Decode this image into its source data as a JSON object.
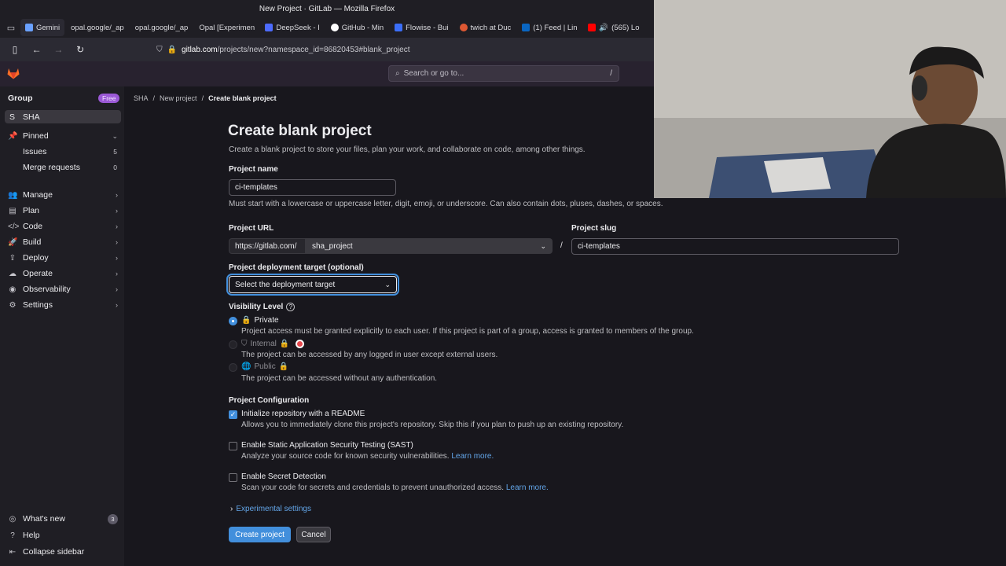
{
  "browser": {
    "window_title": "New Project · GitLab — Mozilla Firefox",
    "tabs": [
      {
        "label": "Gemini",
        "color": "#6aa1ff"
      },
      {
        "label": "opal.google/_ap",
        "color": "#1f1e24"
      },
      {
        "label": "opal.google/_ap",
        "color": "#1f1e24"
      },
      {
        "label": "Opal [Experimen",
        "color": "#1f1e24"
      },
      {
        "label": "DeepSeek - I",
        "color": "#4d6bfe"
      },
      {
        "label": "GitHub - Min",
        "color": "#ffffff"
      },
      {
        "label": "Flowise - Bui",
        "color": "#3b6ef8"
      },
      {
        "label": "twich at Duc",
        "color": "#de5833"
      },
      {
        "label": "(1) Feed | Lin",
        "color": "#0a66c2"
      },
      {
        "label": "(565) Lo",
        "color": "#ff0000"
      }
    ],
    "url_host": "gitlab.com",
    "url_path": "/projects/new?namespace_id=86820453#blank_project"
  },
  "topbar": {
    "search_placeholder": "Search or go to...",
    "search_shortcut": "/"
  },
  "sidebar": {
    "group_label": "Group",
    "plan_badge": "Free",
    "context_initial": "S",
    "context_name": "SHA",
    "pinned_label": "Pinned",
    "pinned_items": [
      {
        "label": "Issues",
        "count": "5"
      },
      {
        "label": "Merge requests",
        "count": "0"
      }
    ],
    "nav_items": [
      {
        "label": "Manage",
        "icon": "users-icon"
      },
      {
        "label": "Plan",
        "icon": "plan-icon"
      },
      {
        "label": "Code",
        "icon": "code-icon"
      },
      {
        "label": "Build",
        "icon": "rocket-icon"
      },
      {
        "label": "Deploy",
        "icon": "deploy-icon"
      },
      {
        "label": "Operate",
        "icon": "cloud-icon"
      },
      {
        "label": "Observability",
        "icon": "eye-icon"
      },
      {
        "label": "Settings",
        "icon": "gear-icon"
      }
    ],
    "whats_new": "What's new",
    "whats_new_count": "3",
    "help": "Help",
    "collapse": "Collapse sidebar"
  },
  "breadcrumb": {
    "items": [
      "SHA",
      "New project",
      "Create blank project"
    ]
  },
  "form": {
    "title": "Create blank project",
    "subtitle": "Create a blank project to store your files, plan your work, and collaborate on code, among other things.",
    "project_name_label": "Project name",
    "project_name_value": "ci-templates",
    "project_name_help": "Must start with a lowercase or uppercase letter, digit, emoji, or underscore. Can also contain dots, pluses, dashes, or spaces.",
    "project_url_label": "Project URL",
    "url_prefix": "https://gitlab.com/",
    "namespace": "sha_project",
    "slug_label": "Project slug",
    "slug_value": "ci-templates",
    "deploy_label": "Project deployment target (optional)",
    "deploy_placeholder": "Select the deployment target",
    "visibility_label": "Visibility Level",
    "visibility": [
      {
        "label": "Private",
        "desc": "Project access must be granted explicitly to each user. If this project is part of a group, access is granted to members of the group.",
        "selected": true,
        "disabled": false
      },
      {
        "label": "Internal",
        "desc": "The project can be accessed by any logged in user except external users.",
        "selected": false,
        "disabled": true
      },
      {
        "label": "Public",
        "desc": "The project can be accessed without any authentication.",
        "selected": false,
        "disabled": true
      }
    ],
    "config_label": "Project Configuration",
    "config": [
      {
        "label": "Initialize repository with a README",
        "desc": "Allows you to immediately clone this project's repository. Skip this if you plan to push up an existing repository.",
        "checked": true,
        "link": ""
      },
      {
        "label": "Enable Static Application Security Testing (SAST)",
        "desc": "Analyze your source code for known security vulnerabilities.",
        "checked": false,
        "link": "Learn more."
      },
      {
        "label": "Enable Secret Detection",
        "desc": "Scan your code for secrets and credentials to prevent unauthorized access.",
        "checked": false,
        "link": "Learn more."
      }
    ],
    "experimental": "Experimental settings",
    "create_button": "Create project",
    "cancel_button": "Cancel"
  },
  "colors": {
    "accent": "#428fdc",
    "topbar": "#28222f",
    "background": "#18171d",
    "badge_purple": "#9b59d6"
  }
}
